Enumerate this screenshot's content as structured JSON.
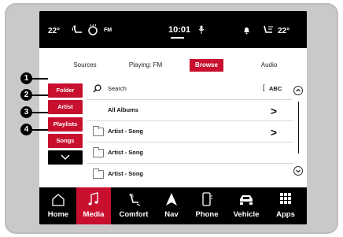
{
  "status": {
    "outside_temp": "22°",
    "radio_band": "FM",
    "time": "10:01",
    "cabin_temp": "22°"
  },
  "tabs": [
    {
      "label": "Sources"
    },
    {
      "label": "Playing: FM"
    },
    {
      "label": "Browse"
    },
    {
      "label": "Audio"
    }
  ],
  "active_tab": "Browse",
  "sidebar": {
    "items": [
      {
        "label": "Folder"
      },
      {
        "label": "Artist"
      },
      {
        "label": "Playlists"
      },
      {
        "label": "Songs"
      }
    ]
  },
  "search": {
    "label": "Search",
    "abc_label": "ABC"
  },
  "list": {
    "items": [
      {
        "label": "All Albums"
      },
      {
        "label": "Artist - Song"
      },
      {
        "label": "Artist - Song"
      },
      {
        "label": "Artist - Song"
      }
    ]
  },
  "nav": {
    "items": [
      {
        "label": "Home",
        "icon": "home-icon"
      },
      {
        "label": "Media",
        "icon": "music-note-icon"
      },
      {
        "label": "Comfort",
        "icon": "seat-icon"
      },
      {
        "label": "Nav",
        "icon": "navigation-arrow-icon"
      },
      {
        "label": "Phone",
        "icon": "phone-icon"
      },
      {
        "label": "Vehicle",
        "icon": "car-icon"
      },
      {
        "label": "Apps",
        "icon": "apps-grid-icon"
      }
    ],
    "active": "Media"
  },
  "callouts": [
    "1",
    "2",
    "3",
    "4"
  ],
  "colors": {
    "accent": "#c8102e",
    "bezel": "#c9c9c9",
    "bar": "#000000"
  }
}
